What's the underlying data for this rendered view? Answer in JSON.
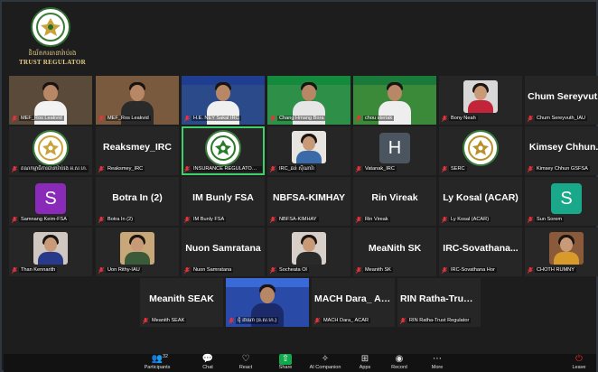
{
  "logo": {
    "khmer": "និយ័តករធានារ៉ាប់រង",
    "english": "TRUST REGULATOR"
  },
  "participants": [
    {
      "name": "",
      "label": "MEF_Ros Leakvid",
      "kind": "video",
      "bg": "#5a4a3a",
      "shirt": "#f2f2f2",
      "banner": ""
    },
    {
      "name": "",
      "label": "MEF_Ros Leakvid",
      "kind": "video",
      "bg": "#7a5a3e",
      "shirt": "#2a2a2a",
      "banner": ""
    },
    {
      "name": "",
      "label": "H.E. NEY Sakal IRC",
      "kind": "video",
      "bg": "#2a4a8a",
      "shirt": "#f0f0f0",
      "banner": "#1f3e91"
    },
    {
      "name": "",
      "label": "Chang Hmang Bora",
      "kind": "video",
      "bg": "#2e8f48",
      "shirt": "#e6e6e6",
      "banner": "#138a3c"
    },
    {
      "name": "",
      "label": "chou steriak",
      "kind": "video",
      "bg": "#3a8a3a",
      "shirt": "#eeeeee",
      "banner": "#1a7a3a"
    },
    {
      "name": "",
      "label": "Bony Neah",
      "kind": "photo",
      "bg": "#d8d8d8",
      "shirt": "#c2253a"
    },
    {
      "name": "Chum Sereyvut...",
      "label": "Chum Sereyvuth_IAU",
      "kind": "name"
    },
    {
      "name": "",
      "label": "គណកម្មាធិការធានារ៉ាប់រង អ.ស.ហ.",
      "kind": "emblem",
      "emblemColor": "#c9a23a"
    },
    {
      "name": "Reaksmey_IRC",
      "label": "Reaksmey_IRC",
      "kind": "name"
    },
    {
      "name": "",
      "label": "INSURANCE REGULATOR of CA...",
      "kind": "emblem",
      "emblemColor": "#2a7a2a",
      "active": true
    },
    {
      "name": "",
      "label": "IRC_ឆន់ ស៊ីណារ៉ា",
      "kind": "photo",
      "bg": "#e8e4e0",
      "shirt": "#3a6aa8"
    },
    {
      "name": "",
      "label": "Vatanak_IRC",
      "kind": "letter",
      "letter": "H",
      "letterBg": "#4a5560"
    },
    {
      "name": "",
      "label": "SERC",
      "kind": "emblem",
      "emblemColor": "#b8902a"
    },
    {
      "name": "Kimsey Chhun...",
      "label": "Kimsey Chhun GSFSA",
      "kind": "name"
    },
    {
      "name": "",
      "label": "Samnang Keim-FSA",
      "kind": "letter",
      "letter": "S",
      "letterBg": "#8a2ab8"
    },
    {
      "name": "Botra In (2)",
      "label": "Botra In (2)",
      "kind": "name"
    },
    {
      "name": "IM Bunly FSA",
      "label": "IM Bunly FSA",
      "kind": "name"
    },
    {
      "name": "NBFSA-KIMHAY",
      "label": "NBFSA-KIMHAY",
      "kind": "name"
    },
    {
      "name": "Rin Vireak",
      "label": "Rin Vireak",
      "kind": "name"
    },
    {
      "name": "Ly Kosal (ACAR)",
      "label": "Ly Kosal (ACAR)",
      "kind": "name"
    },
    {
      "name": "",
      "label": "Sun Sorem",
      "kind": "letter",
      "letter": "S",
      "letterBg": "#1aa88a"
    },
    {
      "name": "",
      "label": "Than Kennarith",
      "kind": "photo",
      "bg": "#d0c8c0",
      "shirt": "#2a3a8a"
    },
    {
      "name": "",
      "label": "Uon Rithy-IAU",
      "kind": "photo",
      "bg": "#c8a878",
      "shirt": "#3a5a3a"
    },
    {
      "name": "Nuon Samratana",
      "label": "Nuon Samratana",
      "kind": "name"
    },
    {
      "name": "",
      "label": "Socheata Ol",
      "kind": "photo",
      "bg": "#d8d0c8",
      "shirt": "#2a2a2a"
    },
    {
      "name": "MeaNith SK",
      "label": "Meanith SK",
      "kind": "name"
    },
    {
      "name": "IRC-Sovathana...",
      "label": "IRC-Sovathana Hor",
      "kind": "name"
    },
    {
      "name": "",
      "label": "CHOTH RUMNY",
      "kind": "photo",
      "bg": "#8a5a3a",
      "shirt": "#d89a2a"
    },
    {
      "name": "Meanith SEAK",
      "label": "Meanith SEAK",
      "kind": "name"
    },
    {
      "name": "",
      "label": "ជុំ ដាណា (ន.ស.ហ.)",
      "kind": "video",
      "bg": "#2a4aa8",
      "shirt": "#1a2a6a",
      "banner": "#3a6ad8"
    },
    {
      "name": "MACH Dara_ AC...",
      "label": "MACH Dara_ ACAR",
      "kind": "name"
    },
    {
      "name": "RIN Ratha-Trust...",
      "label": "RIN Ratha-Trust Regulator",
      "kind": "name"
    }
  ],
  "toolbar": {
    "participants_count": "32",
    "items": [
      {
        "id": "participants",
        "label": "Participants",
        "icon": "participants-icon",
        "glyph": "👥"
      },
      {
        "id": "chat",
        "label": "Chat",
        "icon": "chat-icon",
        "glyph": "💬"
      },
      {
        "id": "react",
        "label": "React",
        "icon": "react-icon",
        "glyph": "♡"
      },
      {
        "id": "share",
        "label": "Share",
        "icon": "share-icon",
        "glyph": "⇧"
      },
      {
        "id": "ai",
        "label": "AI Companion",
        "icon": "sparkle-icon",
        "glyph": "✧"
      },
      {
        "id": "apps",
        "label": "Apps",
        "icon": "apps-icon",
        "glyph": "⊞"
      },
      {
        "id": "record",
        "label": "Record",
        "icon": "record-icon",
        "glyph": "◉"
      },
      {
        "id": "more",
        "label": "More",
        "icon": "more-icon",
        "glyph": "⋯"
      }
    ],
    "leave_label": "Leave",
    "leave_color": "#e02828",
    "share_color": "#0fa84a"
  },
  "colors": {
    "active_outline": "#3fd06a",
    "mic_muted": "#e8323c"
  }
}
